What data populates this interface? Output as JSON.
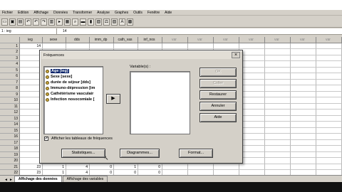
{
  "menubar": [
    "Fichier",
    "Edition",
    "Affichage",
    "Données",
    "Transformer",
    "Analyse",
    "Graphes",
    "Outils",
    "Fenêtre",
    "Aide"
  ],
  "toolbar": [
    "open-icon",
    "save-icon",
    "print-icon",
    "dialog-recall-icon",
    "undo-icon",
    "redo-icon",
    "goto-chart-icon",
    "goto-case-icon",
    "variables-icon",
    "find-icon",
    "insert-case-icon",
    "insert-variable-icon",
    "split-file-icon",
    "weight-cases-icon",
    "select-cases-icon",
    "value-labels-icon",
    "use-sets-icon"
  ],
  "toolbar_glyphs": [
    "▭",
    "▣",
    "▤",
    "↶",
    "↶",
    "↷",
    "▥",
    "▸",
    "▦",
    "⌕",
    "▬",
    "▮",
    "▧",
    "⚖",
    "▨",
    "A",
    "▩"
  ],
  "cellbar": {
    "ref": "1 : ieg",
    "value": "14"
  },
  "grid": {
    "columns": [
      "ieg",
      "sexe",
      "dds",
      "imm_dp",
      "cath_vas",
      "inf_nos",
      "var",
      "var",
      "var",
      "var",
      "var",
      "var",
      "var"
    ],
    "rows": [
      {
        "n": "1",
        "cells": [
          "14",
          "",
          "",
          "",
          "",
          "",
          "",
          "",
          "",
          "",
          "",
          "",
          ""
        ]
      },
      {
        "n": "2",
        "cells": [
          "",
          "",
          "",
          "",
          "",
          "",
          "",
          "",
          "",
          "",
          "",
          "",
          ""
        ]
      },
      {
        "n": "3",
        "cells": [
          "",
          "",
          "",
          "",
          "",
          "",
          "",
          "",
          "",
          "",
          "",
          "",
          ""
        ]
      },
      {
        "n": "4",
        "cells": [
          "",
          "",
          "",
          "",
          "",
          "",
          "",
          "",
          "",
          "",
          "",
          "",
          ""
        ]
      },
      {
        "n": "5",
        "cells": [
          "",
          "",
          "",
          "",
          "",
          "",
          "",
          "",
          "",
          "",
          "",
          "",
          ""
        ]
      },
      {
        "n": "6",
        "cells": [
          "",
          "",
          "",
          "",
          "",
          "",
          "",
          "",
          "",
          "",
          "",
          "",
          ""
        ]
      },
      {
        "n": "7",
        "cells": [
          "",
          "",
          "",
          "",
          "",
          "",
          "",
          "",
          "",
          "",
          "",
          "",
          ""
        ]
      },
      {
        "n": "8",
        "cells": [
          "",
          "",
          "",
          "",
          "",
          "",
          "",
          "",
          "",
          "",
          "",
          "",
          ""
        ]
      },
      {
        "n": "9",
        "cells": [
          "",
          "",
          "",
          "",
          "",
          "",
          "",
          "",
          "",
          "",
          "",
          "",
          ""
        ]
      },
      {
        "n": "10",
        "cells": [
          "",
          "",
          "",
          "",
          "",
          "",
          "",
          "",
          "",
          "",
          "",
          "",
          ""
        ]
      },
      {
        "n": "11",
        "cells": [
          "",
          "",
          "",
          "",
          "",
          "",
          "",
          "",
          "",
          "",
          "",
          "",
          ""
        ]
      },
      {
        "n": "12",
        "cells": [
          "",
          "",
          "",
          "",
          "",
          "",
          "",
          "",
          "",
          "",
          "",
          "",
          ""
        ]
      },
      {
        "n": "13",
        "cells": [
          "",
          "",
          "",
          "",
          "",
          "",
          "",
          "",
          "",
          "",
          "",
          "",
          ""
        ]
      },
      {
        "n": "14",
        "cells": [
          "",
          "",
          "",
          "",
          "",
          "",
          "",
          "",
          "",
          "",
          "",
          "",
          ""
        ]
      },
      {
        "n": "15",
        "cells": [
          "",
          "",
          "",
          "",
          "",
          "",
          "",
          "",
          "",
          "",
          "",
          "",
          ""
        ]
      },
      {
        "n": "16",
        "cells": [
          "",
          "",
          "",
          "",
          "",
          "",
          "",
          "",
          "",
          "",
          "",
          "",
          ""
        ]
      },
      {
        "n": "17",
        "cells": [
          "",
          "",
          "",
          "",
          "",
          "",
          "",
          "",
          "",
          "",
          "",
          "",
          ""
        ]
      },
      {
        "n": "18",
        "cells": [
          "",
          "",
          "",
          "",
          "",
          "",
          "",
          "",
          "",
          "",
          "",
          "",
          ""
        ]
      },
      {
        "n": "19",
        "cells": [
          "",
          "",
          "",
          "",
          "",
          "",
          "",
          "",
          "",
          "",
          "",
          "",
          ""
        ]
      },
      {
        "n": "20",
        "cells": [
          "",
          "",
          "",
          "",
          "",
          "",
          "",
          "",
          "",
          "",
          "",
          "",
          ""
        ]
      },
      {
        "n": "21",
        "cells": [
          "23",
          "1",
          "4",
          "0",
          "1",
          "0",
          "",
          "",
          "",
          "",
          "",
          "",
          ""
        ]
      },
      {
        "n": "22",
        "cells": [
          "23",
          "1",
          "4",
          "0",
          "0",
          "0",
          "",
          "",
          "",
          "",
          "",
          "",
          ""
        ]
      }
    ]
  },
  "dialog": {
    "title": "Fréquences",
    "close_label": "×",
    "variables": [
      {
        "label": "Age [ieg]",
        "selected": true
      },
      {
        "label": "Sexe [sexe]",
        "selected": false
      },
      {
        "label": "durée de séjour [dds]",
        "selected": false
      },
      {
        "label": "Immuno-dépression [im",
        "selected": false
      },
      {
        "label": "Cathétérisme vasculair",
        "selected": false
      },
      {
        "label": "Infection nosocomiale [",
        "selected": false
      }
    ],
    "move_label": "▶",
    "target_label": "Variable(s) :",
    "side_buttons": [
      {
        "label": "OK",
        "disabled": true
      },
      {
        "label": "Coller",
        "disabled": true
      },
      {
        "label": "Restaurer",
        "disabled": false
      },
      {
        "label": "Annuler",
        "disabled": false
      },
      {
        "label": "Aide",
        "disabled": false
      }
    ],
    "checkbox_label": "Afficher les tableaux de fréquences",
    "checkbox_mark": "✓",
    "checkbox_checked": true,
    "bottom_buttons": [
      "Statistiques...",
      "Diagrammes...",
      "Format..."
    ]
  },
  "tabs": {
    "nav": [
      "◄",
      "►"
    ],
    "items": [
      {
        "label": "Affichage des données",
        "active": true
      },
      {
        "label": "Affichage des variables",
        "active": false
      }
    ]
  }
}
